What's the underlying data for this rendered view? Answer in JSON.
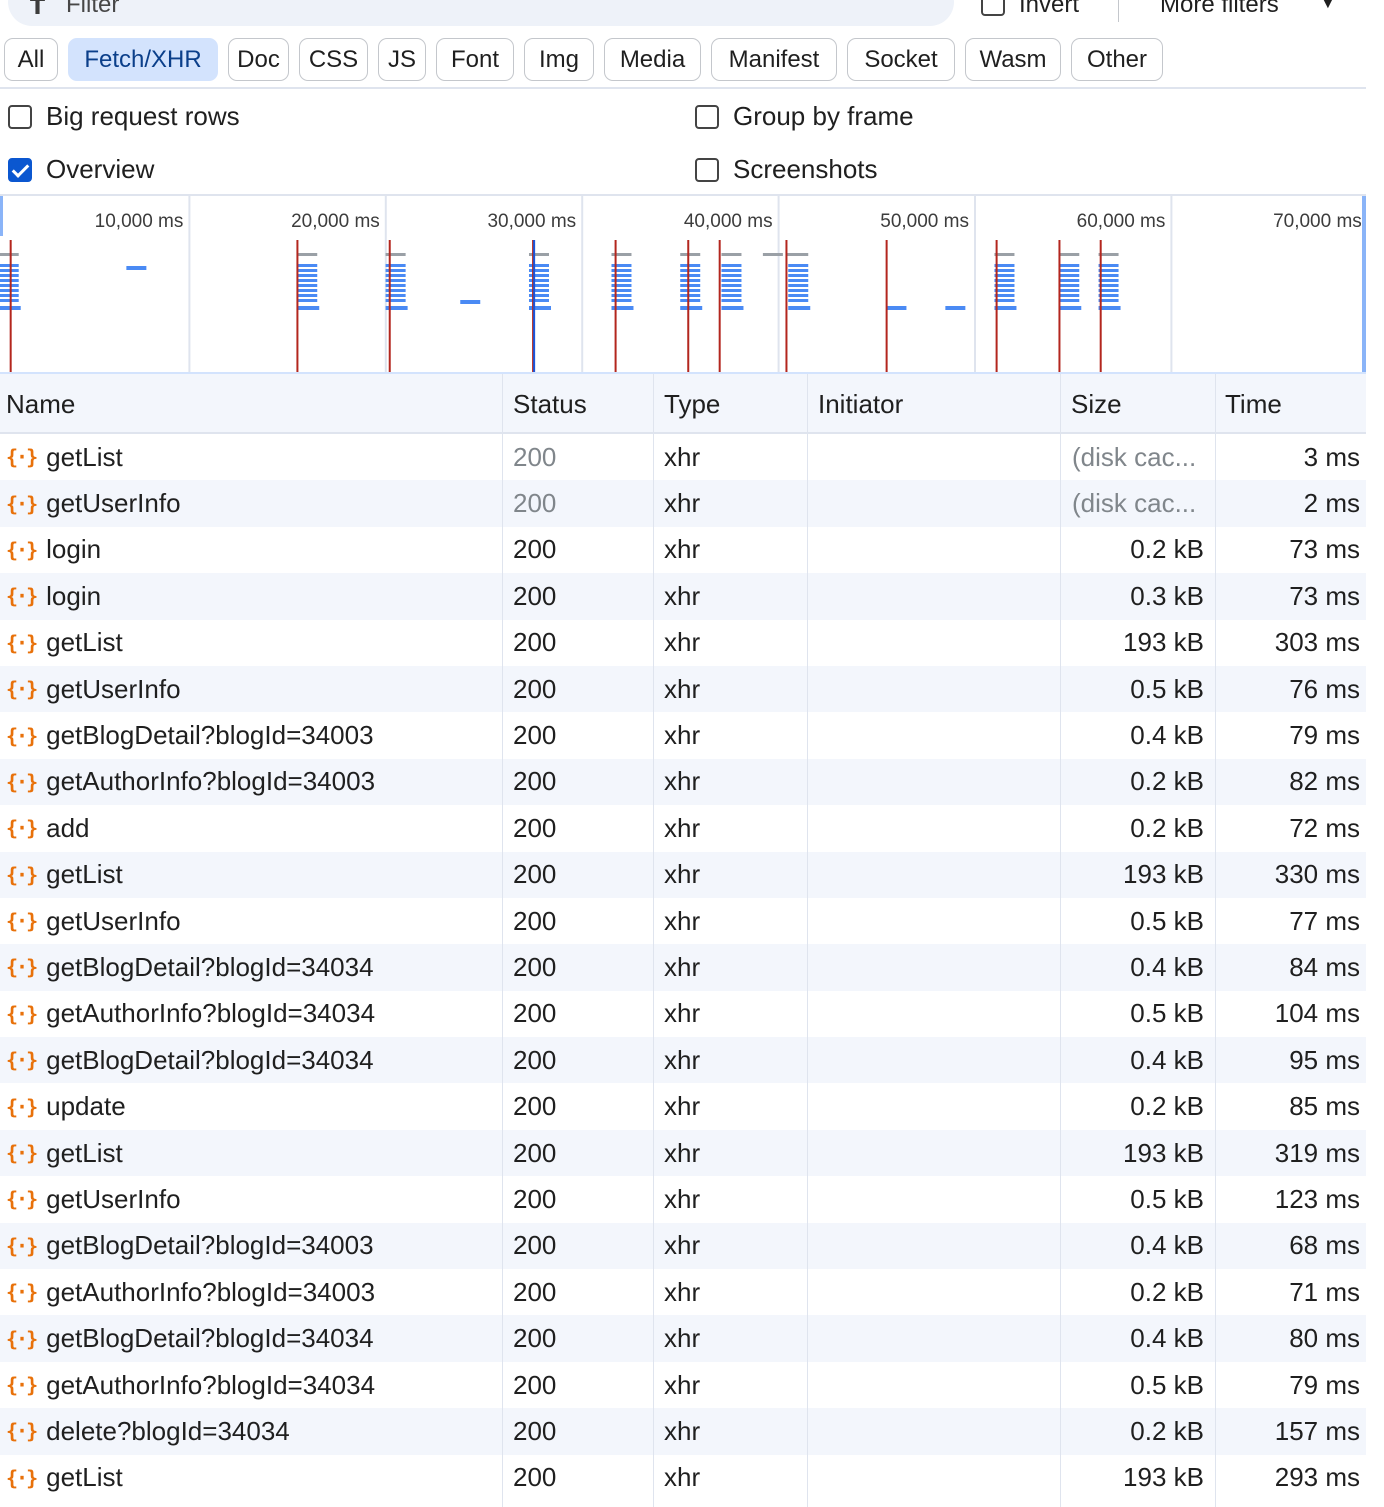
{
  "filter_bar": {
    "filter_icon": "funnel-icon",
    "placeholder": "Filter",
    "invert_label": "Invert",
    "invert_checked": false,
    "more_filters_label": "More filters",
    "more_caret": "▼"
  },
  "type_chips": [
    {
      "label": "All",
      "active": false
    },
    {
      "label": "Fetch/XHR",
      "active": true
    },
    {
      "label": "Doc",
      "active": false
    },
    {
      "label": "CSS",
      "active": false
    },
    {
      "label": "JS",
      "active": false
    },
    {
      "label": "Font",
      "active": false
    },
    {
      "label": "Img",
      "active": false
    },
    {
      "label": "Media",
      "active": false
    },
    {
      "label": "Manifest",
      "active": false
    },
    {
      "label": "Socket",
      "active": false
    },
    {
      "label": "Wasm",
      "active": false
    },
    {
      "label": "Other",
      "active": false
    }
  ],
  "options": {
    "big_request_rows": {
      "label": "Big request rows",
      "checked": false
    },
    "group_by_frame": {
      "label": "Group by frame",
      "checked": false
    },
    "overview": {
      "label": "Overview",
      "checked": true
    },
    "screenshots": {
      "label": "Screenshots",
      "checked": false
    }
  },
  "overview_timeline": {
    "tick_labels": [
      "10,000 ms",
      "20,000 ms",
      "30,000 ms",
      "40,000 ms",
      "50,000 ms",
      "60,000 ms",
      "70,000 ms"
    ],
    "load_markers_ms": [
      900,
      15500,
      20200,
      27500,
      31700,
      35400,
      37000,
      40400,
      45500,
      51100,
      54300,
      56400
    ],
    "dom_marker_ms": [
      27400
    ],
    "request_clusters_ms": [
      800,
      7300,
      16000,
      20500,
      24300,
      27800,
      32000,
      35500,
      37600,
      41000,
      46000,
      49000,
      51500,
      54800,
      56800
    ],
    "colors": {
      "load_marker": "#b3261e",
      "dom_marker": "#1a56db",
      "request_bar": "#4a8af4",
      "waiting_bar": "#9aa0a6"
    }
  },
  "table": {
    "columns": [
      "Name",
      "Status",
      "Type",
      "Initiator",
      "Size",
      "Time"
    ],
    "row_icon": "xhr-braces-icon",
    "rows": [
      {
        "name": "getList",
        "status": "200",
        "type": "xhr",
        "initiator": "",
        "size": "(disk cac...",
        "time": "3 ms",
        "cached": true
      },
      {
        "name": "getUserInfo",
        "status": "200",
        "type": "xhr",
        "initiator": "",
        "size": "(disk cac...",
        "time": "2 ms",
        "cached": true
      },
      {
        "name": "login",
        "status": "200",
        "type": "xhr",
        "initiator": "",
        "size": "0.2 kB",
        "time": "73 ms",
        "cached": false
      },
      {
        "name": "login",
        "status": "200",
        "type": "xhr",
        "initiator": "",
        "size": "0.3 kB",
        "time": "73 ms",
        "cached": false
      },
      {
        "name": "getList",
        "status": "200",
        "type": "xhr",
        "initiator": "",
        "size": "193 kB",
        "time": "303 ms",
        "cached": false
      },
      {
        "name": "getUserInfo",
        "status": "200",
        "type": "xhr",
        "initiator": "",
        "size": "0.5 kB",
        "time": "76 ms",
        "cached": false
      },
      {
        "name": "getBlogDetail?blogId=34003",
        "status": "200",
        "type": "xhr",
        "initiator": "",
        "size": "0.4 kB",
        "time": "79 ms",
        "cached": false
      },
      {
        "name": "getAuthorInfo?blogId=34003",
        "status": "200",
        "type": "xhr",
        "initiator": "",
        "size": "0.2 kB",
        "time": "82 ms",
        "cached": false
      },
      {
        "name": "add",
        "status": "200",
        "type": "xhr",
        "initiator": "",
        "size": "0.2 kB",
        "time": "72 ms",
        "cached": false
      },
      {
        "name": "getList",
        "status": "200",
        "type": "xhr",
        "initiator": "",
        "size": "193 kB",
        "time": "330 ms",
        "cached": false
      },
      {
        "name": "getUserInfo",
        "status": "200",
        "type": "xhr",
        "initiator": "",
        "size": "0.5 kB",
        "time": "77 ms",
        "cached": false
      },
      {
        "name": "getBlogDetail?blogId=34034",
        "status": "200",
        "type": "xhr",
        "initiator": "",
        "size": "0.4 kB",
        "time": "84 ms",
        "cached": false
      },
      {
        "name": "getAuthorInfo?blogId=34034",
        "status": "200",
        "type": "xhr",
        "initiator": "",
        "size": "0.5 kB",
        "time": "104 ms",
        "cached": false
      },
      {
        "name": "getBlogDetail?blogId=34034",
        "status": "200",
        "type": "xhr",
        "initiator": "",
        "size": "0.4 kB",
        "time": "95 ms",
        "cached": false
      },
      {
        "name": "update",
        "status": "200",
        "type": "xhr",
        "initiator": "",
        "size": "0.2 kB",
        "time": "85 ms",
        "cached": false
      },
      {
        "name": "getList",
        "status": "200",
        "type": "xhr",
        "initiator": "",
        "size": "193 kB",
        "time": "319 ms",
        "cached": false
      },
      {
        "name": "getUserInfo",
        "status": "200",
        "type": "xhr",
        "initiator": "",
        "size": "0.5 kB",
        "time": "123 ms",
        "cached": false
      },
      {
        "name": "getBlogDetail?blogId=34003",
        "status": "200",
        "type": "xhr",
        "initiator": "",
        "size": "0.4 kB",
        "time": "68 ms",
        "cached": false
      },
      {
        "name": "getAuthorInfo?blogId=34003",
        "status": "200",
        "type": "xhr",
        "initiator": "",
        "size": "0.2 kB",
        "time": "71 ms",
        "cached": false
      },
      {
        "name": "getBlogDetail?blogId=34034",
        "status": "200",
        "type": "xhr",
        "initiator": "",
        "size": "0.4 kB",
        "time": "80 ms",
        "cached": false
      },
      {
        "name": "getAuthorInfo?blogId=34034",
        "status": "200",
        "type": "xhr",
        "initiator": "",
        "size": "0.5 kB",
        "time": "79 ms",
        "cached": false
      },
      {
        "name": "delete?blogId=34034",
        "status": "200",
        "type": "xhr",
        "initiator": "",
        "size": "0.2 kB",
        "time": "157 ms",
        "cached": false
      },
      {
        "name": "getList",
        "status": "200",
        "type": "xhr",
        "initiator": "",
        "size": "193 kB",
        "time": "293 ms",
        "cached": false
      }
    ]
  }
}
